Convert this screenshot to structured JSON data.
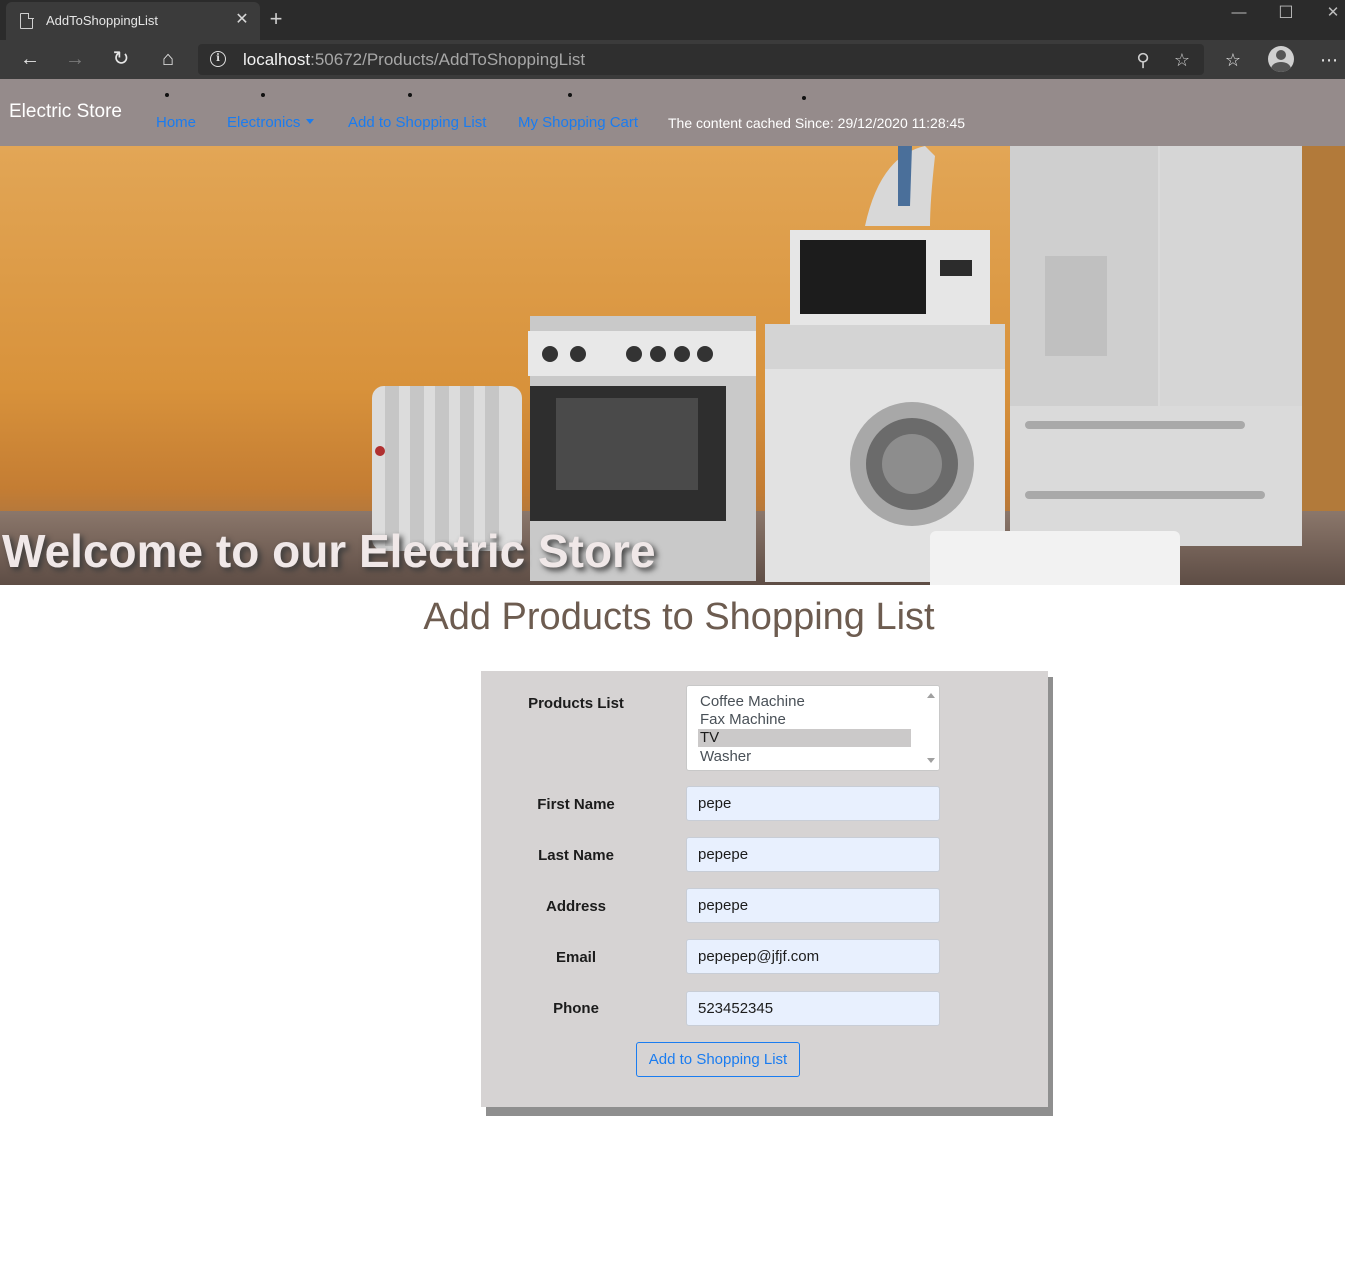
{
  "browser": {
    "tab_title": "AddToShoppingList",
    "url_host": "localhost",
    "url_rest": ":50672/Products/AddToShoppingList"
  },
  "navbar": {
    "brand": "Electric Store",
    "links": {
      "home": "Home",
      "electronics": "Electronics",
      "add_to_list": "Add to Shopping List",
      "cart": "My Shopping Cart"
    },
    "cache_text": "The content cached Since: 29/12/2020 11:28:45"
  },
  "hero": {
    "heading": "Welcome to our Electric Store"
  },
  "page": {
    "title": "Add Products to Shopping List"
  },
  "form": {
    "products_label": "Products List",
    "products": [
      "Coffee Machine",
      "Fax Machine",
      "TV",
      "Washer"
    ],
    "selected_product": "TV",
    "first_name_label": "First Name",
    "first_name": "pepe",
    "last_name_label": "Last Name",
    "last_name": "pepepe",
    "address_label": "Address",
    "address": "pepepe",
    "email_label": "Email",
    "email": "pepepep@jfjf.com",
    "phone_label": "Phone",
    "phone": "523452345",
    "submit_label": "Add to Shopping List"
  },
  "colors": {
    "navbar_bg": "#958b8b",
    "link": "#1a7cf0",
    "form_bg": "#d6d3d3",
    "title": "#6d5c50"
  }
}
